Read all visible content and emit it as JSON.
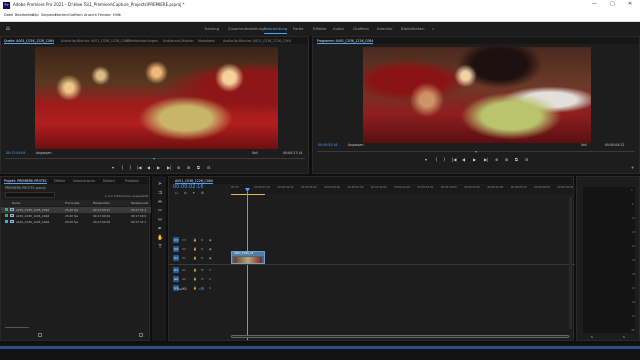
{
  "titlebar": {
    "logo": "Pr",
    "title": "Adobe Premiere Pro 2021 - D:\\How To\\1_Premiere\\Capture_Projects\\PREMIERE.prproj *",
    "minimize": "—",
    "maximize": "▢",
    "close": "✕"
  },
  "menu": {
    "items": [
      "Datei",
      "Bearbeiten",
      "Clip",
      "Sequenz",
      "Marken",
      "Grafiken",
      "Ansicht",
      "Fenster",
      "Hilfe"
    ]
  },
  "workspaces": {
    "items": [
      "Training",
      "Zusammenstellung",
      "Bearbeitung",
      "Farbe",
      "Effekte",
      "Audio",
      "Grafiken",
      "Interlink",
      "Bibliotheken"
    ],
    "active_index": 2,
    "more": "»"
  },
  "source": {
    "tabs": [
      "Quelle: A001_C036_1226_C064",
      "Audioclip-Mischer: A001_C036_1226_C064",
      "Effekteinstellungen",
      "Audiotrack-Mischer",
      "Metadaten",
      "Audioclip-Mischer: A001_C036_1226_C064"
    ],
    "timecode_in": "00:17:04:09",
    "fit": "Anpassen",
    "quality": "Voll",
    "timecode_dur": "00:00:27:14"
  },
  "program": {
    "tabs": [
      "Programm: A001_C036_1226_C064"
    ],
    "timecode_in": "00:00:02:16",
    "fit": "Anpassen",
    "quality": "Voll",
    "timecode_dur": "00:00:04:22"
  },
  "transport": {
    "source_buttons": [
      "▾",
      "{",
      "}",
      "|◀",
      "◀",
      "▶",
      "▶|",
      "⊕",
      "⊞",
      "⧉",
      "⊟"
    ],
    "program_buttons": [
      "▾",
      "{",
      "}",
      "|◀",
      "◀",
      "▶",
      "▶|",
      "⊕",
      "⊞",
      "⧉",
      "⊟",
      "+"
    ]
  },
  "project": {
    "tabs": [
      "Projekt: PREMIERE-PROTEC",
      "Effekte",
      "Informationen",
      "Marken",
      "Protokoll"
    ],
    "path": "PREMIERE-PROTEC.prproj",
    "item_count": "1 von 5 Elementen ausgewählt",
    "columns": [
      "Name",
      "Framerate",
      "Medienstart",
      "Medienende"
    ],
    "rows": [
      {
        "name": "A001_C036_1226_C064",
        "fps": "25,00 fps",
        "start": "00:17:03:21",
        "end": "00:17:31:1",
        "selected": true,
        "color": "#3fae54"
      },
      {
        "name": "A001_C036_1226_C064",
        "fps": "25,00 fps",
        "start": "00:17:04:09",
        "end": "00:17:09:0",
        "selected": false,
        "color": "#3fae54"
      },
      {
        "name": "A001_C036_1226_C064",
        "fps": "25,00 fps",
        "start": "00:17:04:09",
        "end": "00:17:31:1",
        "selected": false,
        "color": "#4aa3ff"
      }
    ]
  },
  "timeline": {
    "tab": "A001_C036_1226_C064",
    "timecode": "00:00:02:16",
    "ruler": [
      "00:00",
      "00:00:02:00",
      "00:00:04:00",
      "00:00:06:00",
      "00:00:08:00",
      "00:00:10:00",
      "00:00:12:00",
      "00:00:14:00",
      "00:00:16:00",
      "00:00:18:00",
      "00:00:20:00",
      "00:00:22:00",
      "00:00:24:00",
      "00:00:26:00",
      "00:00:28:00"
    ],
    "video_tracks": [
      "V3",
      "V2",
      "V1"
    ],
    "audio_tracks": [
      "A1",
      "A2",
      "A3"
    ],
    "master": "Master",
    "master_value": "0,0",
    "clip_label": "A001_C036_12"
  },
  "meter": {
    "scale": [
      "0",
      "-6",
      "-12",
      "-18",
      "-24",
      "-30",
      "-36",
      "-42",
      "-48",
      "-54",
      "dB"
    ],
    "solo_left": "S",
    "solo_right": "S"
  }
}
